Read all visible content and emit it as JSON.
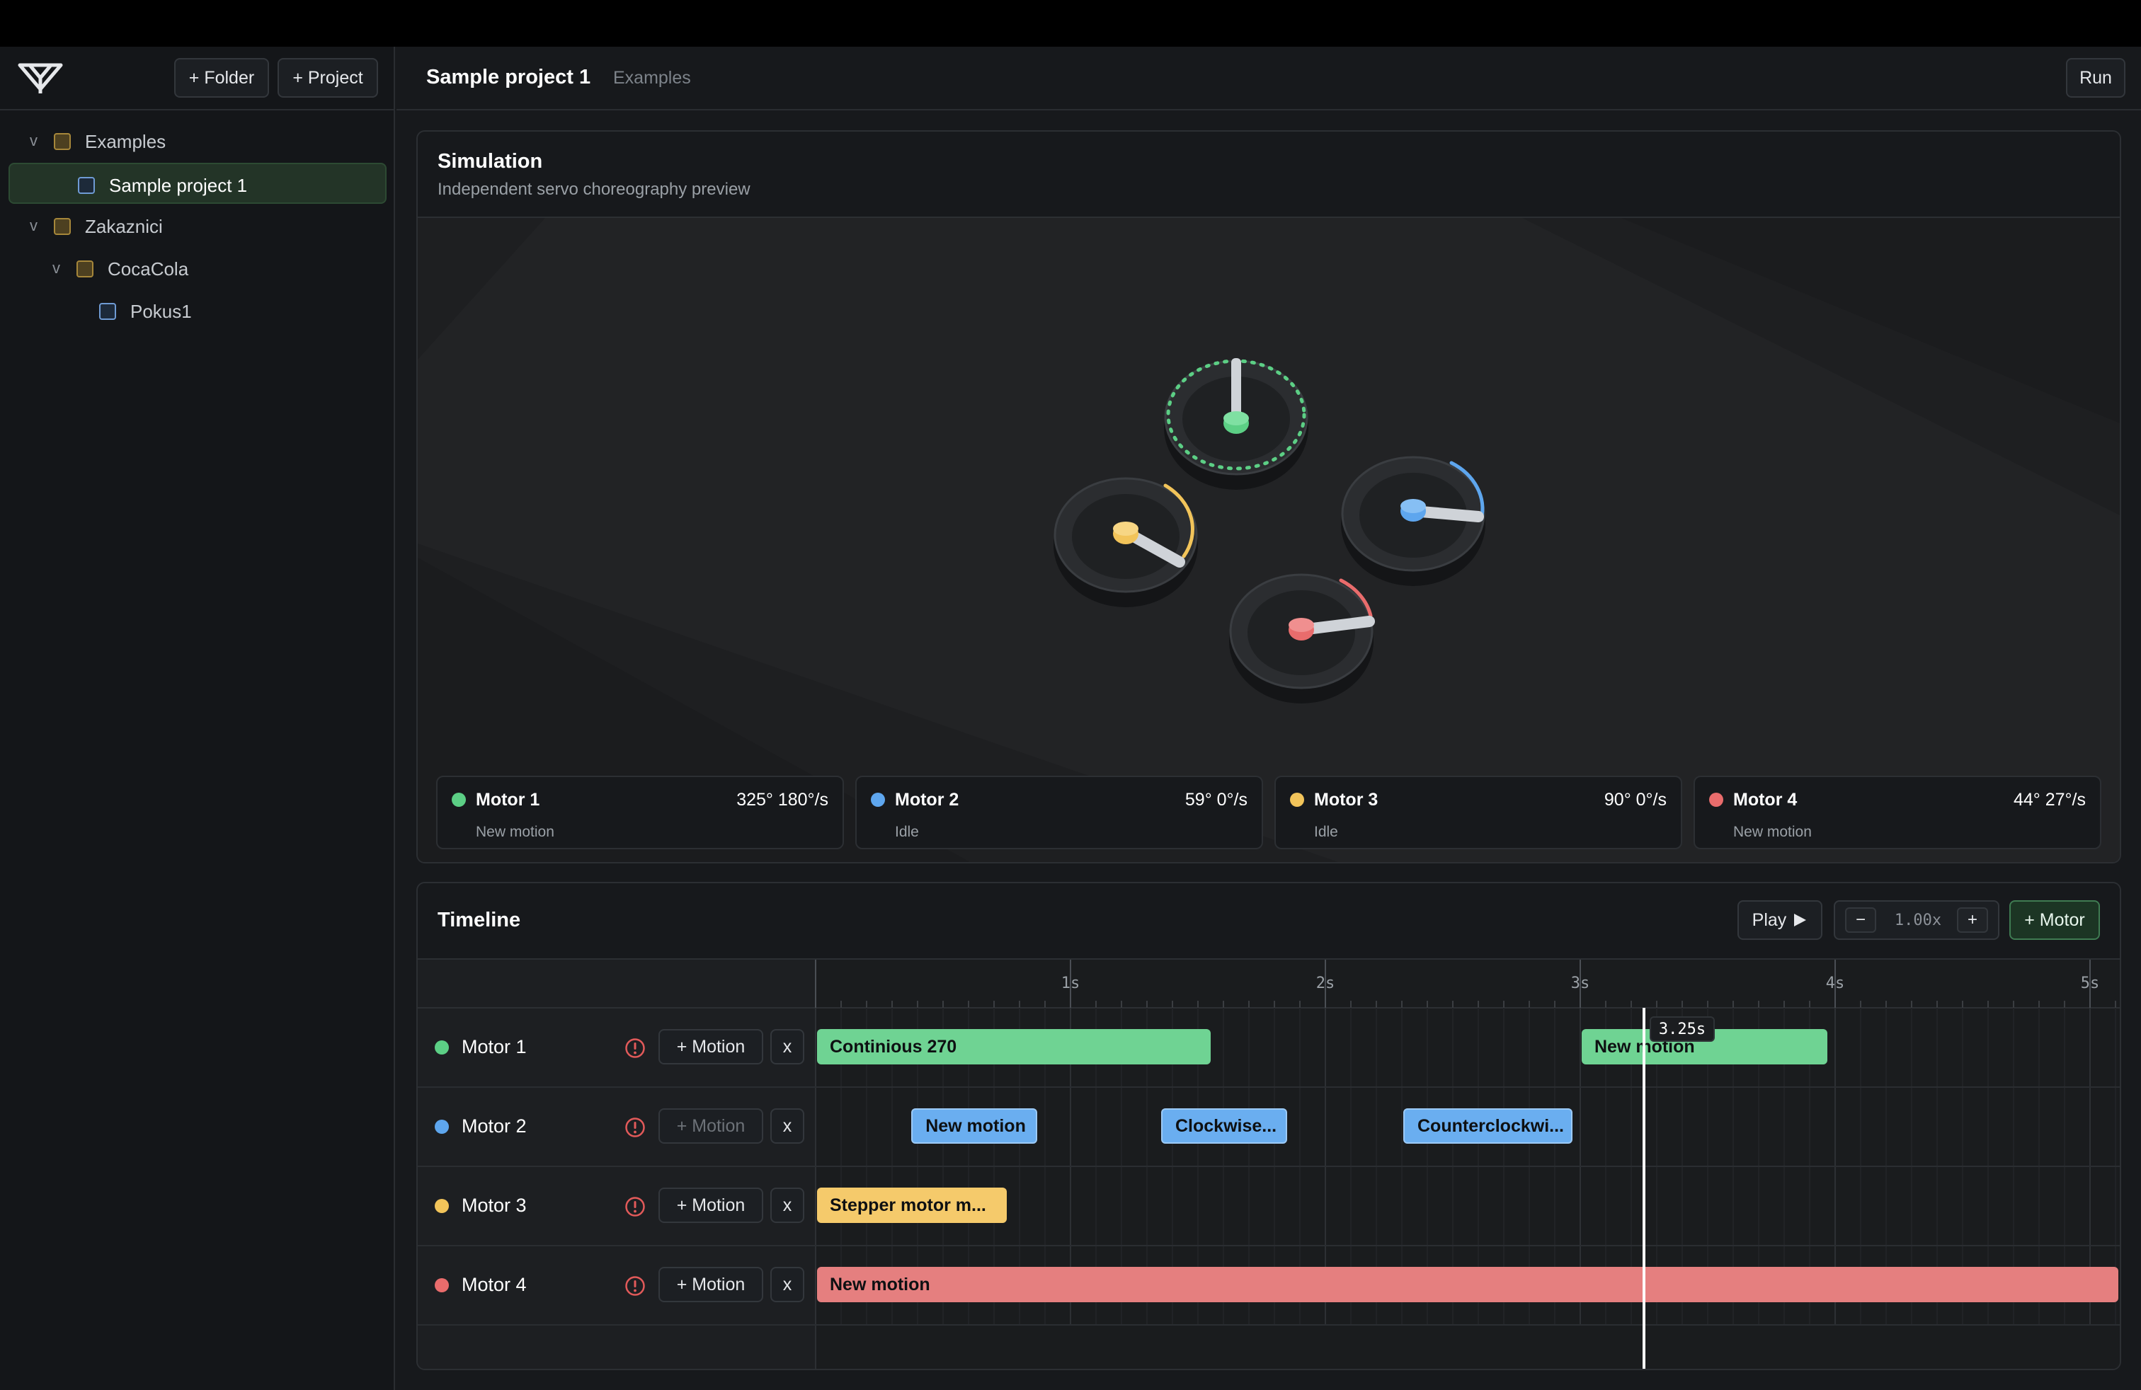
{
  "sidebar": {
    "add_folder_label": "+ Folder",
    "add_project_label": "+ Project",
    "tree": [
      {
        "label": "Examples",
        "type": "folder",
        "depth": 0,
        "expanded": true,
        "chevron": "v"
      },
      {
        "label": "Sample project 1",
        "type": "project",
        "depth": 1,
        "selected": true
      },
      {
        "label": "Zakaznici",
        "type": "folder",
        "depth": 0,
        "expanded": true,
        "chevron": "v"
      },
      {
        "label": "CocaCola",
        "type": "folder",
        "depth": 1,
        "expanded": true,
        "chevron": "v"
      },
      {
        "label": "Pokus1",
        "type": "project",
        "depth": 2
      }
    ]
  },
  "topbar": {
    "title": "Sample project 1",
    "folder": "Examples",
    "run_label": "Run"
  },
  "simulation": {
    "title": "Simulation",
    "subtitle": "Independent servo choreography preview",
    "motors": [
      {
        "name": "Motor 1",
        "angle": "325°",
        "speed": "180°/s",
        "reading": "325°  180°/s",
        "status": "New motion",
        "color": "#5ccf85"
      },
      {
        "name": "Motor 2",
        "angle": "59°",
        "speed": "0°/s",
        "reading": "59°  0°/s",
        "status": "Idle",
        "color": "#5ea6ee"
      },
      {
        "name": "Motor 3",
        "angle": "90°",
        "speed": "0°/s",
        "reading": "90°  0°/s",
        "status": "Idle",
        "color": "#f2c45a"
      },
      {
        "name": "Motor 4",
        "angle": "44°",
        "speed": "27°/s",
        "reading": "44°  27°/s",
        "status": "New motion",
        "color": "#e96c6c"
      }
    ]
  },
  "timeline": {
    "title": "Timeline",
    "play_label": "Play",
    "speed_minus": "−",
    "speed_value": "1.00x",
    "speed_plus": "+",
    "add_motor_label": "+ Motor",
    "ticks": [
      "1s",
      "2s",
      "3s",
      "4s",
      "5s"
    ],
    "playhead_label": "3.25s",
    "playhead_time": 3.25,
    "tracks": [
      {
        "name": "Motor 1",
        "add_motion_label": "+ Motion",
        "add_motion_enabled": true,
        "delete_label": "x",
        "clips": [
          {
            "label": "Continious 270",
            "start": 0.0,
            "end": 1.55
          },
          {
            "label": "New motion",
            "start": 3.0,
            "end": 3.97
          }
        ]
      },
      {
        "name": "Motor 2",
        "add_motion_label": "+ Motion",
        "add_motion_enabled": false,
        "delete_label": "x",
        "clips": [
          {
            "label": "New motion",
            "start": 0.37,
            "end": 0.87
          },
          {
            "label": "Clockwise...",
            "start": 1.35,
            "end": 1.85
          },
          {
            "label": "Counterclockwi...",
            "start": 2.3,
            "end": 2.97
          }
        ]
      },
      {
        "name": "Motor 3",
        "add_motion_label": "+ Motion",
        "add_motion_enabled": true,
        "delete_label": "x",
        "clips": [
          {
            "label": "Stepper motor m...",
            "start": 0.0,
            "end": 0.75
          }
        ]
      },
      {
        "name": "Motor 4",
        "add_motion_label": "+ Motion",
        "add_motion_enabled": true,
        "delete_label": "x",
        "clips": [
          {
            "label": "New motion",
            "start": 0.0,
            "end": 5.12
          }
        ]
      }
    ]
  },
  "colors": {
    "motor1": "#5ccf85",
    "motor2": "#5ea6ee",
    "motor3": "#f2c45a",
    "motor4": "#e96c6c",
    "motor1_clip": "#6fd393",
    "motor2_clip": "#6aaef0",
    "motor3_clip": "#f5ca6b",
    "motor4_clip": "#e57f7f",
    "accent_green": "#3f7b52"
  },
  "icons": {
    "logo": "brand-logo-icon",
    "folder": "folder-icon",
    "project": "project-file-icon",
    "warning": "warning-icon",
    "play": "play-triangle-icon"
  }
}
